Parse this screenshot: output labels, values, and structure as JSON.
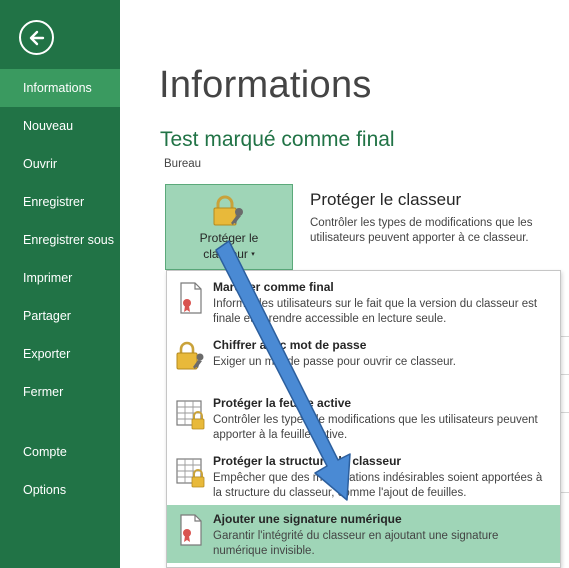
{
  "sidebar": {
    "back_icon": "back-arrow-icon",
    "items": [
      {
        "label": "Informations",
        "active": true
      },
      {
        "label": "Nouveau"
      },
      {
        "label": "Ouvrir"
      },
      {
        "label": "Enregistrer"
      },
      {
        "label": "Enregistrer sous"
      },
      {
        "label": "Imprimer"
      },
      {
        "label": "Partager"
      },
      {
        "label": "Exporter"
      },
      {
        "label": "Fermer"
      },
      {
        "label": "Compte"
      },
      {
        "label": "Options"
      }
    ]
  },
  "main": {
    "title": "Informations",
    "document_name": "Test marqué comme final",
    "document_location": "Bureau",
    "protect": {
      "button_line1": "Protéger le",
      "button_line2": "classeur",
      "caret": "▾",
      "heading": "Protéger le classeur",
      "description": "Contrôler les types de modifications que les utilisateurs peuvent apporter à ce classeur."
    }
  },
  "menu": {
    "items": [
      {
        "title": "Marquer comme final",
        "description": "Informer les utilisateurs sur le fait que la version du classeur est finale et le rendre accessible en lecture seule.",
        "icon": "document-ribbon-icon"
      },
      {
        "title": "Chiffrer avec mot de passe",
        "description": "Exiger un mot de passe pour ouvrir ce classeur.",
        "icon": "lock-key-icon"
      },
      {
        "title": "Protéger la feuille active",
        "description": "Contrôler les types de modifications que les utilisateurs peuvent apporter à la feuille active.",
        "icon": "sheet-lock-icon"
      },
      {
        "title": "Protéger la structure du classeur",
        "description": "Empêcher que des modifications indésirables soient apportées à la structure du classeur, comme l'ajout de feuilles.",
        "icon": "workbook-lock-icon"
      },
      {
        "title": "Ajouter une signature numérique",
        "description": "Garantir l'intégrité du classeur en ajoutant une signature numérique invisible.",
        "icon": "signature-ribbon-icon",
        "highlighted": true
      }
    ]
  },
  "colors": {
    "sidebar": "#217346",
    "sidebar_active": "#3a9a60",
    "accent_text": "#217346",
    "highlight": "#9fd5b7",
    "annotation_arrow": "#4a8ad4"
  }
}
